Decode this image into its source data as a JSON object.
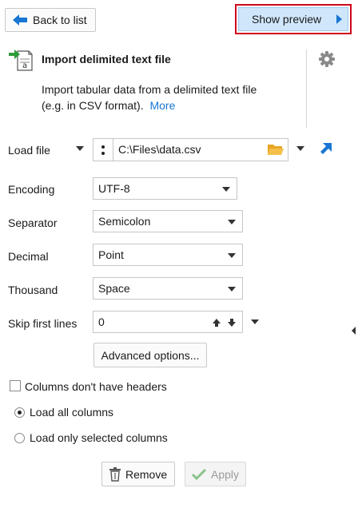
{
  "header": {
    "back_label": "Back to list",
    "preview_label": "Show preview"
  },
  "node": {
    "title": "Import delimited text file",
    "description_line1": "Import tabular data from a delimited text file",
    "description_line2": "(e.g. in CSV format).",
    "more_link": "More"
  },
  "form": {
    "load_file_label": "Load file",
    "load_file_value": "C:\\Files\\data.csv",
    "encoding_label": "Encoding",
    "encoding_value": "UTF-8",
    "separator_label": "Separator",
    "separator_value": "Semicolon",
    "decimal_label": "Decimal",
    "decimal_value": "Point",
    "thousand_label": "Thousand",
    "thousand_value": "Space",
    "skip_label": "Skip first lines",
    "skip_value": "0",
    "advanced_label": "Advanced options...",
    "no_headers_label": "Columns don't have headers",
    "load_all_label": "Load all columns",
    "load_selected_label": "Load only selected columns"
  },
  "footer": {
    "remove_label": "Remove",
    "apply_label": "Apply"
  },
  "colors": {
    "accent": "#1976d2",
    "preview_bg": "#cfe6fb",
    "highlight_border": "#d0021b",
    "folder": "#f1b43a",
    "apply_check": "#8bc48b"
  }
}
